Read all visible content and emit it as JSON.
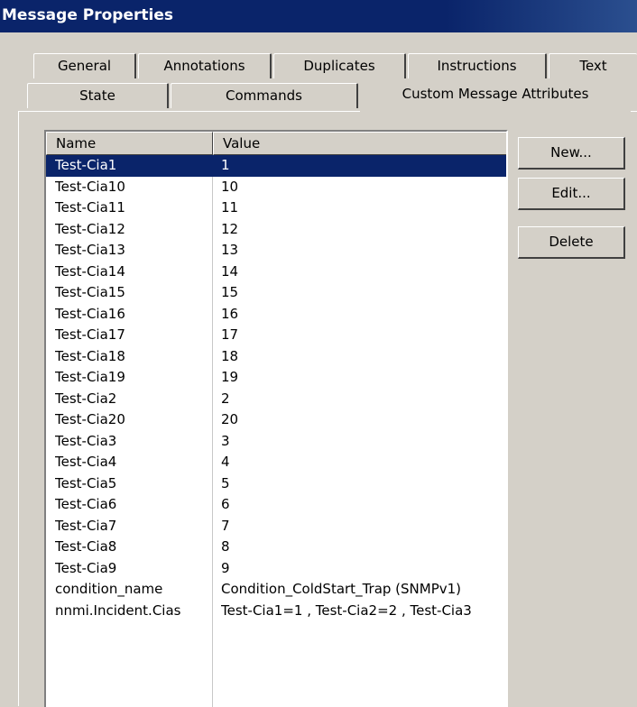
{
  "window": {
    "title": "Message Properties"
  },
  "tabs": {
    "row1": [
      "General",
      "Annotations",
      "Duplicates",
      "Instructions",
      "Text"
    ],
    "row2": [
      "State",
      "Commands",
      "Custom Message Attributes"
    ],
    "active": "Custom Message Attributes"
  },
  "attributes_list": {
    "columns": {
      "name": "Name",
      "value": "Value"
    },
    "selected_index": 0,
    "rows": [
      {
        "name": "Test-Cia1",
        "value": "1"
      },
      {
        "name": "Test-Cia10",
        "value": "10"
      },
      {
        "name": "Test-Cia11",
        "value": "11"
      },
      {
        "name": "Test-Cia12",
        "value": "12"
      },
      {
        "name": "Test-Cia13",
        "value": "13"
      },
      {
        "name": "Test-Cia14",
        "value": "14"
      },
      {
        "name": "Test-Cia15",
        "value": "15"
      },
      {
        "name": "Test-Cia16",
        "value": "16"
      },
      {
        "name": "Test-Cia17",
        "value": "17"
      },
      {
        "name": "Test-Cia18",
        "value": "18"
      },
      {
        "name": "Test-Cia19",
        "value": "19"
      },
      {
        "name": "Test-Cia2",
        "value": "2"
      },
      {
        "name": "Test-Cia20",
        "value": "20"
      },
      {
        "name": "Test-Cia3",
        "value": "3"
      },
      {
        "name": "Test-Cia4",
        "value": "4"
      },
      {
        "name": "Test-Cia5",
        "value": "5"
      },
      {
        "name": "Test-Cia6",
        "value": "6"
      },
      {
        "name": "Test-Cia7",
        "value": "7"
      },
      {
        "name": "Test-Cia8",
        "value": "8"
      },
      {
        "name": "Test-Cia9",
        "value": "9"
      },
      {
        "name": "condition_name",
        "value": "Condition_ColdStart_Trap (SNMPv1)"
      },
      {
        "name": "nnmi.Incident.Cias",
        "value": "Test-Cia1=1 , Test-Cia2=2 , Test-Cia3"
      }
    ]
  },
  "buttons": {
    "new": "New...",
    "edit": "Edit...",
    "delete": "Delete"
  },
  "colors": {
    "titlebar": "#0a246a",
    "selection": "#0a246a",
    "dialog_bg": "#d4d0c8"
  }
}
